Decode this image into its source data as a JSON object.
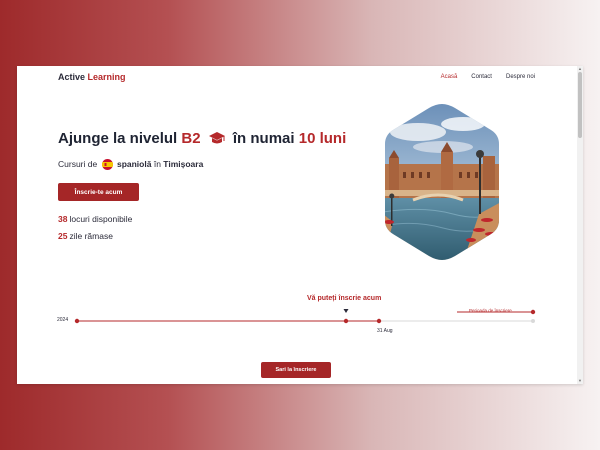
{
  "header": {
    "logo_part1": "Active",
    "logo_part2": "Learning",
    "nav": [
      {
        "label": "Acasă",
        "active": true
      },
      {
        "label": "Contact",
        "active": false
      },
      {
        "label": "Despre noi",
        "active": false
      }
    ]
  },
  "hero": {
    "title_prefix": "Ajunge la nivelul",
    "title_level": "B2",
    "title_middle": "în numai",
    "title_duration": "10 luni",
    "subtitle_prefix": "Cursuri de",
    "language": "spaniolă",
    "subtitle_middle": "în",
    "city": "Timișoara",
    "cta_label": "Înscrie-te acum",
    "stats": [
      {
        "value": "38",
        "label": "locuri disponibile"
      },
      {
        "value": "25",
        "label": "zile rămase"
      }
    ],
    "image_icon": "seville-plaza-photo"
  },
  "timeline": {
    "heading": "Vă puteți înscrie acum",
    "start_label": "2024",
    "marker_label": "31 Aug",
    "period_label": "Perioada de înscriere"
  },
  "footer_button": "Sari la înscriere",
  "colors": {
    "accent": "#b5292b",
    "button": "#a52627",
    "text": "#1f2433"
  }
}
